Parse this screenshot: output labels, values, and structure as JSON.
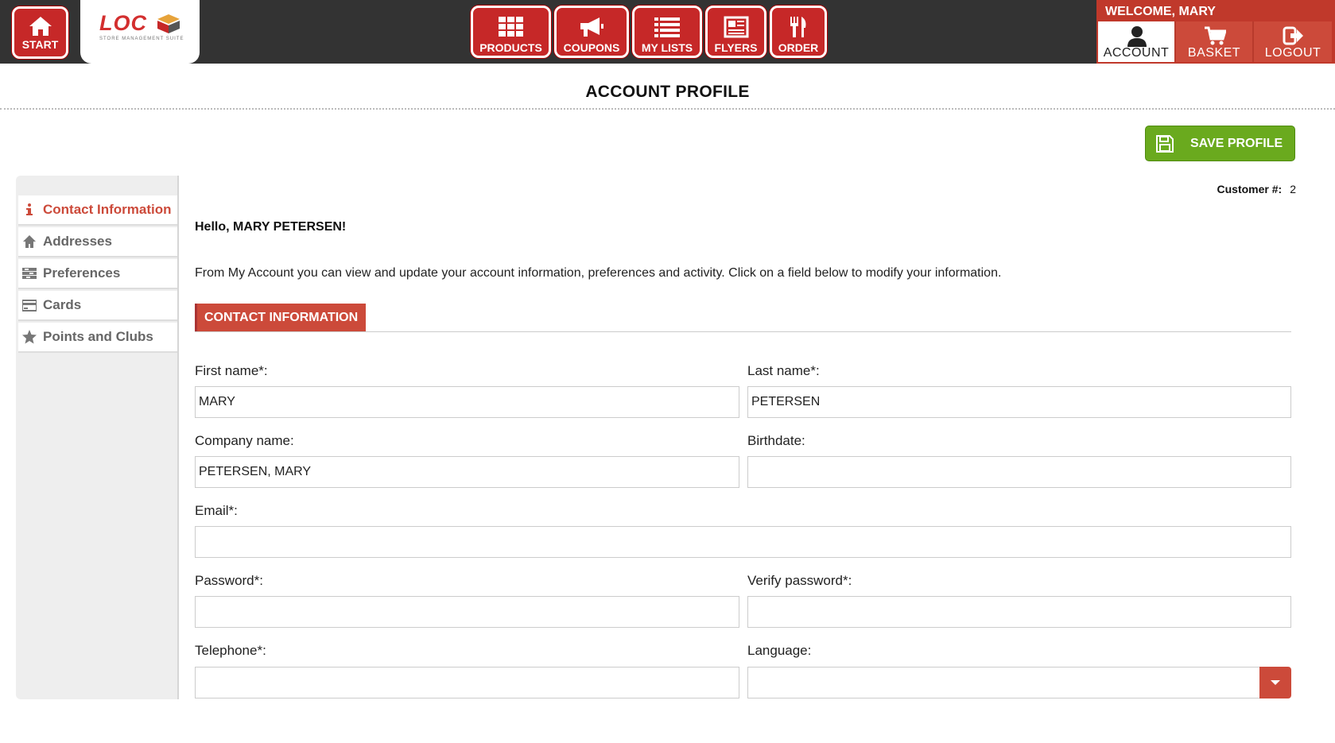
{
  "brand": {
    "logo_text": "LOC",
    "logo_sub": "STORE MANAGEMENT SUITE",
    "accent": "#c62828"
  },
  "topbar": {
    "start_label": "START",
    "nav": [
      {
        "label": "PRODUCTS",
        "icon": "grid-icon"
      },
      {
        "label": "COUPONS",
        "icon": "megaphone-icon"
      },
      {
        "label": "MY LISTS",
        "icon": "list-icon"
      },
      {
        "label": "FLYERS",
        "icon": "newspaper-icon"
      },
      {
        "label": "ORDER",
        "icon": "utensils-icon"
      }
    ],
    "welcome": "WELCOME, MARY",
    "account_label": "ACCOUNT",
    "basket_label": "BASKET",
    "logout_label": "LOGOUT"
  },
  "page": {
    "title": "ACCOUNT PROFILE",
    "save_label": "SAVE PROFILE",
    "customer_label": "Customer #:",
    "customer_number": "2",
    "hello": "Hello, MARY PETERSEN!",
    "intro": "From My Account you can view and update your account information, preferences and activity. Click on a field below to modify your information.",
    "section_title": "CONTACT INFORMATION"
  },
  "sidebar": {
    "items": [
      {
        "label": "Contact Information",
        "icon": "info-icon"
      },
      {
        "label": "Addresses",
        "icon": "home-icon"
      },
      {
        "label": "Preferences",
        "icon": "sliders-icon"
      },
      {
        "label": "Cards",
        "icon": "credit-card-icon"
      },
      {
        "label": "Points and Clubs",
        "icon": "star-icon"
      }
    ]
  },
  "form": {
    "first_name": {
      "label": "First name*:",
      "value": "MARY"
    },
    "last_name": {
      "label": "Last name*:",
      "value": "PETERSEN"
    },
    "company": {
      "label": "Company name:",
      "value": "PETERSEN, MARY"
    },
    "birthdate": {
      "label": "Birthdate:",
      "value": ""
    },
    "email": {
      "label": "Email*:",
      "value": ""
    },
    "password": {
      "label": "Password*:",
      "value": ""
    },
    "verify_password": {
      "label": "Verify password*:",
      "value": ""
    },
    "telephone": {
      "label": "Telephone*:",
      "value": ""
    },
    "language": {
      "label": "Language:",
      "value": ""
    }
  }
}
